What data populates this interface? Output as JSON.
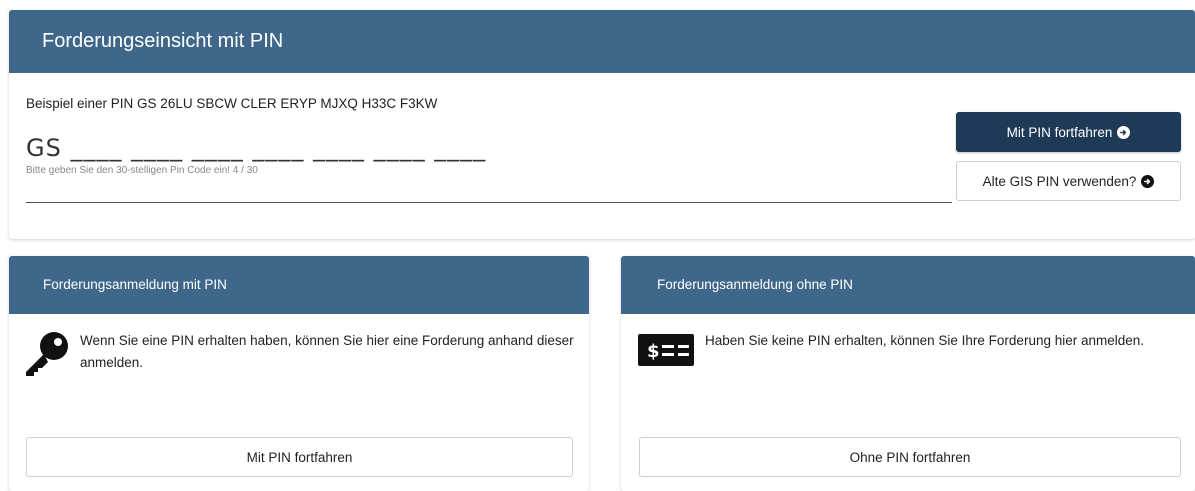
{
  "top": {
    "title": "Forderungseinsicht mit PIN",
    "example": "Beispiel einer PIN GS 26LU SBCW CLER ERYP MJXQ H33C F3KW",
    "pin_value": "GS ____ ____ ____ ____ ____ ____ ____",
    "pin_hint": "Bitte geben Sie den 30-stelligen Pin Code ein! 4 / 30",
    "btn_continue": "Mit PIN fortfahren",
    "btn_old_pin": "Alte GIS PIN verwenden?"
  },
  "card_with_pin": {
    "title": "Forderungsanmeldung mit PIN",
    "text": "Wenn Sie eine PIN erhalten haben, können Sie hier eine Forderung anhand dieser anmelden.",
    "icon": "key-icon",
    "button": "Mit PIN fortfahren"
  },
  "card_without_pin": {
    "title": "Forderungsanmeldung ohne PIN",
    "text": "Haben Sie keine PIN erhalten, können Sie Ihre Forderung hier anmelden.",
    "icon": "money-check-icon",
    "button": "Ohne PIN fortfahren"
  },
  "colors": {
    "header": "#3e678a",
    "primary_button": "#1f3a57"
  }
}
